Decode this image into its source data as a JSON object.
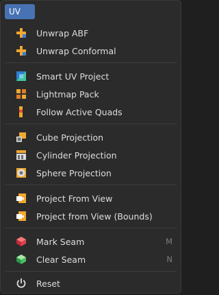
{
  "menu": {
    "title": "UV",
    "sections": [
      [
        {
          "label": "Unwrap ABF",
          "icon": "unwrap-icon"
        },
        {
          "label": "Unwrap Conformal",
          "icon": "unwrap-icon"
        }
      ],
      [
        {
          "label": "Smart UV Project",
          "icon": "smart-uv-icon"
        },
        {
          "label": "Lightmap Pack",
          "icon": "lightmap-icon"
        },
        {
          "label": "Follow Active Quads",
          "icon": "follow-quads-icon"
        }
      ],
      [
        {
          "label": "Cube Projection",
          "icon": "cube-projection-icon"
        },
        {
          "label": "Cylinder Projection",
          "icon": "cylinder-projection-icon"
        },
        {
          "label": "Sphere Projection",
          "icon": "sphere-projection-icon"
        }
      ],
      [
        {
          "label": "Project From View",
          "icon": "project-view-icon"
        },
        {
          "label": "Project from View (Bounds)",
          "icon": "project-view-icon"
        }
      ],
      [
        {
          "label": "Mark Seam",
          "icon": "mark-seam-icon",
          "shortcut": "M"
        },
        {
          "label": "Clear Seam",
          "icon": "clear-seam-icon",
          "shortcut": "N"
        }
      ],
      [
        {
          "label": "Reset",
          "icon": "power-icon"
        }
      ]
    ]
  }
}
